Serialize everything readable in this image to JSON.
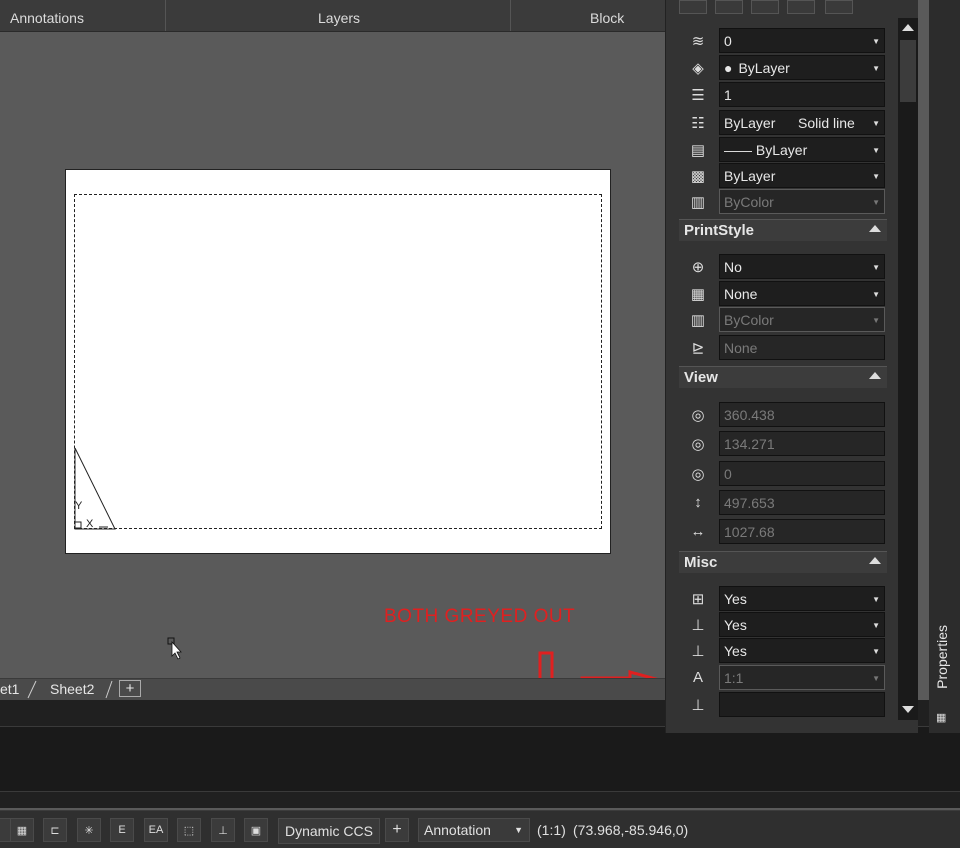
{
  "ribbon": {
    "annotations": "Annotations",
    "layers": "Layers",
    "block": "Block"
  },
  "canvas": {
    "ucs_y": "Y",
    "ucs_x": "X"
  },
  "tabs": {
    "sheet1": "et1",
    "sheet2": "Sheet2",
    "add": "+"
  },
  "overlay": {
    "note": "BOTH GREYED OUT",
    "color": "#e02020"
  },
  "status": {
    "ccs": "Dynamic CCS",
    "plus": "+",
    "annotation": "Annotation",
    "scale": "(1:1)",
    "coords": "(73.968,-85.946,0)"
  },
  "panel": {
    "general": {
      "layer": "0",
      "color": "ByLayer",
      "linescale": "1",
      "linetype": "ByLayer",
      "linetype_right": "Solid line",
      "lineweight": "—— ByLayer",
      "transparency": "ByLayer",
      "plotstyle": "ByColor"
    },
    "printstyle": {
      "title": "PrintStyle",
      "plot": "No",
      "table": "None",
      "bycolor": "ByColor",
      "none": "None"
    },
    "view": {
      "title": "View",
      "cx": "360.438",
      "cy": "134.271",
      "cz": "0",
      "height": "497.653",
      "width": "1027.68"
    },
    "misc": {
      "title": "Misc",
      "yes1": "Yes",
      "yes2": "Yes",
      "yes3": "Yes",
      "scale": "1:1",
      "empty": ""
    },
    "side_label": "Properties"
  }
}
